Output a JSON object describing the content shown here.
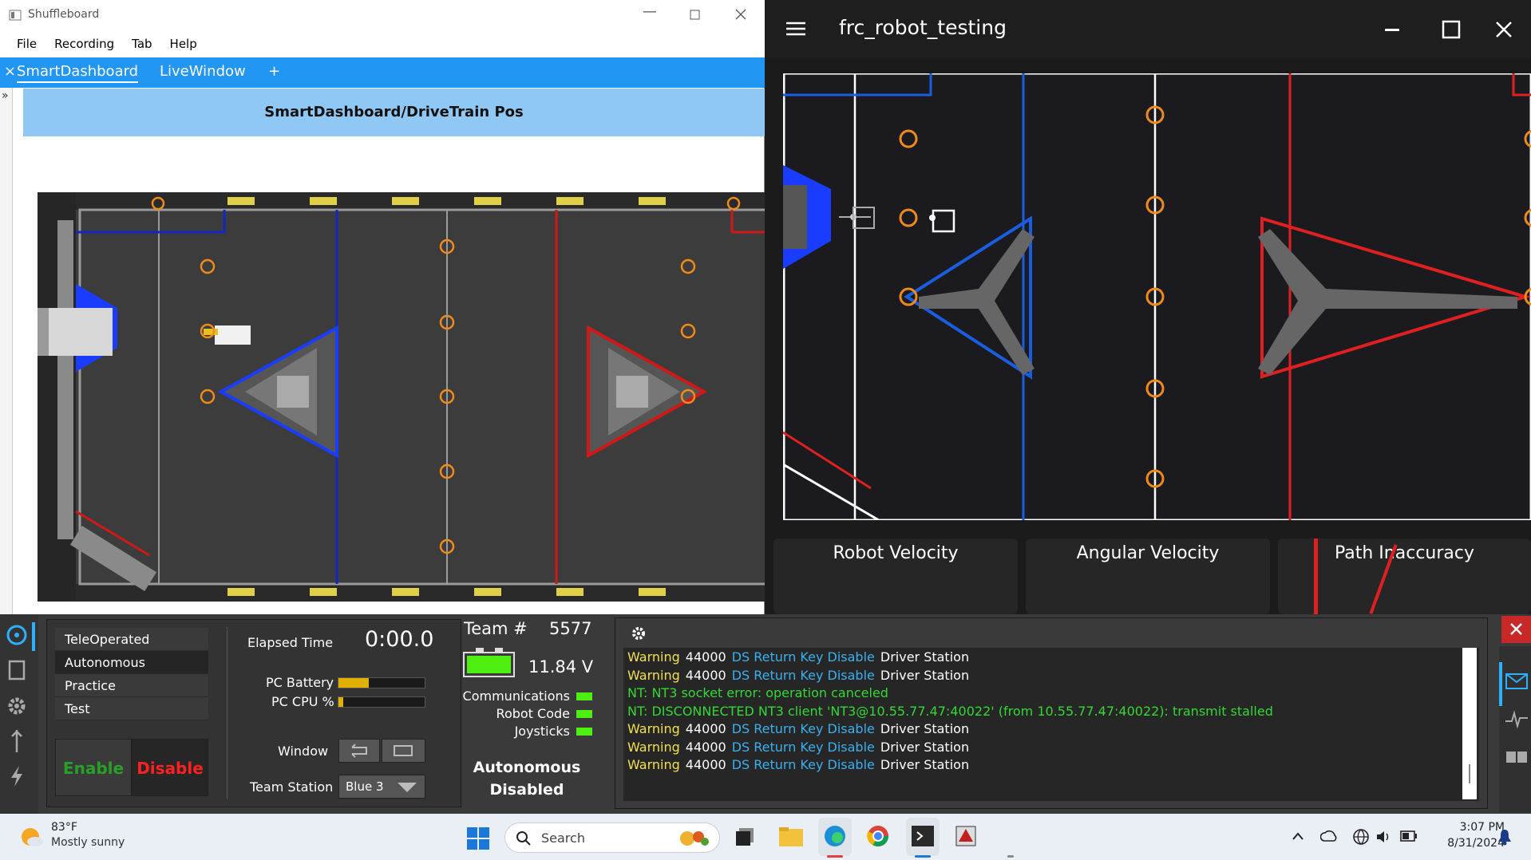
{
  "shuffleboard": {
    "title": "Shuffleboard",
    "menu": [
      "File",
      "Recording",
      "Tab",
      "Help"
    ],
    "tabs": {
      "close": "×",
      "active": "SmartDashboard",
      "other": "LiveWindow",
      "add": "+"
    },
    "expand": "»",
    "widget_title": "SmartDashboard/DriveTrain Pos"
  },
  "frc": {
    "title": "frc_robot_testing",
    "gauges": [
      "Robot Velocity",
      "Angular Velocity",
      "Path Inaccuracy"
    ]
  },
  "ds": {
    "modes": [
      "TeleOperated",
      "Autonomous",
      "Practice",
      "Test"
    ],
    "enable": "Enable",
    "disable": "Disable",
    "elapsed_label": "Elapsed Time",
    "elapsed": "0:00.0",
    "pc_battery": "PC Battery",
    "pc_battery_level": 0.35,
    "pc_cpu": "PC CPU %",
    "pc_cpu_level": 0.06,
    "window": "Window",
    "team_station_label": "Team Station",
    "team_station": "Blue 3",
    "team_label": "Team #",
    "team": "5577",
    "voltage": "11.84 V",
    "communications": "Communications",
    "robot_code": "Robot Code",
    "joysticks": "Joysticks",
    "status": [
      "Autonomous",
      "Disabled"
    ],
    "log": [
      {
        "t": "w",
        "a": "Warning",
        "b": "44000",
        "c": "DS Return Key Disable",
        "d": "Driver Station"
      },
      {
        "t": "w",
        "a": "Warning",
        "b": "44000",
        "c": "DS Return Key Disable",
        "d": "Driver Station"
      },
      {
        "t": "g",
        "text": "NT: NT3 socket error: operation canceled"
      },
      {
        "t": "g",
        "text": "NT: DISCONNECTED NT3 client 'NT3@10.55.77.47:40022' (from 10.55.77.47:40022): transmit stalled"
      },
      {
        "t": "w",
        "a": "Warning",
        "b": "44000",
        "c": "DS Return Key Disable",
        "d": "Driver Station"
      },
      {
        "t": "w",
        "a": "Warning",
        "b": "44000",
        "c": "DS Return Key Disable",
        "d": "Driver Station"
      },
      {
        "t": "w",
        "a": "Warning",
        "b": "44000",
        "c": "DS Return Key Disable",
        "d": "Driver Station"
      }
    ]
  },
  "taskbar": {
    "temp": "83°F",
    "weather": "Mostly sunny",
    "search": "Search",
    "time": "3:07 PM",
    "date": "8/31/2024"
  },
  "colors": {
    "accent": "#2196f3",
    "blue": "#1450d8",
    "red": "#e02020",
    "orange": "#e8880c",
    "green": "#4eee10"
  }
}
